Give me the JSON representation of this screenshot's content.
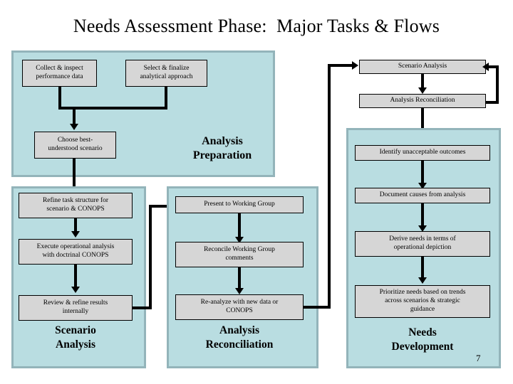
{
  "slide": {
    "title": "Needs Assessment Phase:  Major Tasks & Flows",
    "page_number": "7"
  },
  "colors": {
    "panel_fill": "#b9dde1",
    "panel_border": "#93b4ba",
    "box_fill": "#d6d6d6",
    "box_border": "#000000",
    "connector": "#000000",
    "background": "#ffffff"
  },
  "overview_flow": {
    "nodes": [
      {
        "label": "Scenario Analysis"
      },
      {
        "label": "Analysis Reconciliation"
      }
    ]
  },
  "phases": [
    {
      "id": "analysis-preparation",
      "heading": "Analysis\nPreparation",
      "heading_line1": "Analysis",
      "heading_line2": "Preparation",
      "boxes": [
        {
          "label": "Collect & inspect\nperformance data",
          "line1": "Collect & inspect",
          "line2": "performance data"
        },
        {
          "label": "Select & finalize\nanalytical approach",
          "line1": "Select & finalize",
          "line2": "analytical approach"
        },
        {
          "label": "Choose best-\nunderstood scenario",
          "line1": "Choose best-",
          "line2": "understood scenario"
        }
      ]
    },
    {
      "id": "scenario-analysis",
      "heading_line1": "Scenario",
      "heading_line2": "Analysis",
      "boxes": [
        {
          "line1": "Refine task structure for",
          "line2": "scenario & CONOPS"
        },
        {
          "line1": "Execute operational analysis",
          "line2": "with doctrinal CONOPS"
        },
        {
          "line1": "Review & refine results",
          "line2": "internally"
        }
      ]
    },
    {
      "id": "analysis-reconciliation",
      "heading_line1": "Analysis",
      "heading_line2": "Reconciliation",
      "boxes": [
        {
          "line1": "Present to Working  Group",
          "line2": ""
        },
        {
          "line1": "Reconcile Working Group",
          "line2": "comments"
        },
        {
          "line1": "Re-analyze with new data or",
          "line2": "CONOPS"
        }
      ]
    },
    {
      "id": "needs-development",
      "heading_line1": "Needs",
      "heading_line2": "Development",
      "boxes": [
        {
          "line1": "Identify unacceptable outcomes",
          "line2": ""
        },
        {
          "line1": "Document causes from analysis",
          "line2": ""
        },
        {
          "line1": "Derive needs in terms of",
          "line2": "operational depiction"
        },
        {
          "line1": "Prioritize needs based on trends",
          "line2": "across scenarios & strategic",
          "line3": "guidance"
        }
      ]
    }
  ]
}
